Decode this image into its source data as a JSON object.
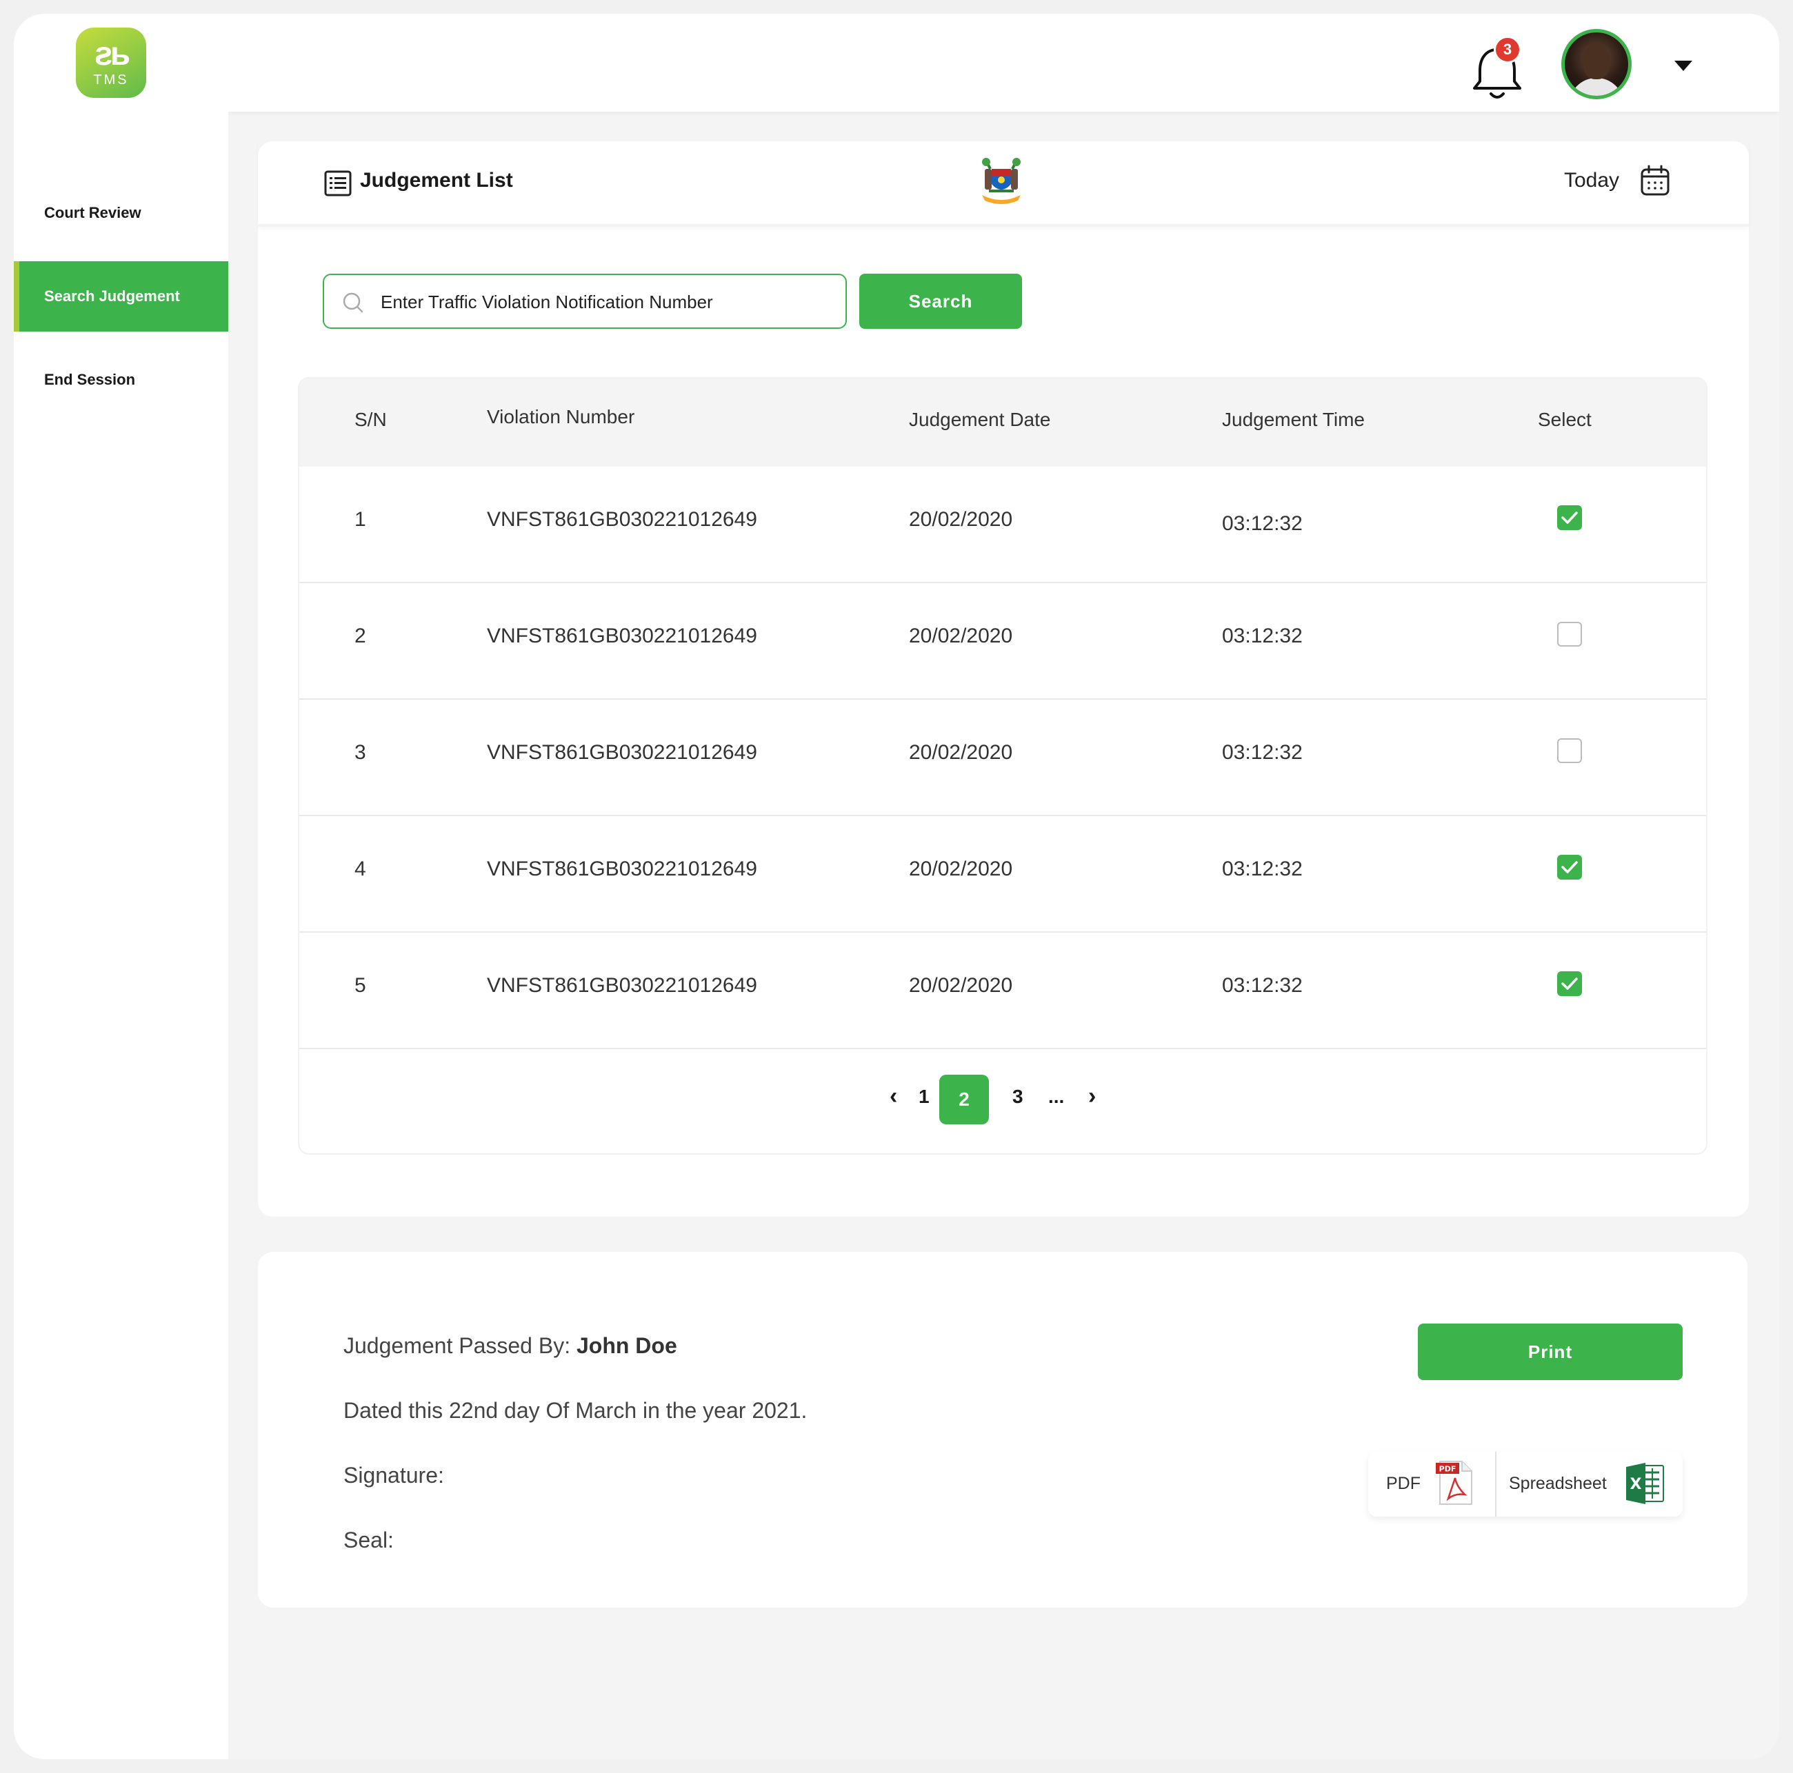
{
  "brand": {
    "logo_text": "TMS"
  },
  "header": {
    "notification_count": "3"
  },
  "sidebar": {
    "items": [
      {
        "label": "Court Review"
      },
      {
        "label": "Search Judgement"
      },
      {
        "label": "End Session"
      }
    ],
    "active_index": 1
  },
  "judgement_list": {
    "title": "Judgement List",
    "date_filter": "Today",
    "search": {
      "placeholder": "Enter Traffic Violation Notification Number",
      "button_label": "Search"
    },
    "columns": [
      "S/N",
      "Violation Number",
      "Judgement Date",
      "Judgement Time",
      "Select"
    ],
    "rows": [
      {
        "sn": "1",
        "violation_number": "VNFST861GB030221012649",
        "date": "20/02/2020",
        "time": "03:12:32",
        "selected": true
      },
      {
        "sn": "2",
        "violation_number": "VNFST861GB030221012649",
        "date": "20/02/2020",
        "time": "03:12:32",
        "selected": false
      },
      {
        "sn": "3",
        "violation_number": "VNFST861GB030221012649",
        "date": "20/02/2020",
        "time": "03:12:32",
        "selected": false
      },
      {
        "sn": "4",
        "violation_number": "VNFST861GB030221012649",
        "date": "20/02/2020",
        "time": "03:12:32",
        "selected": true
      },
      {
        "sn": "5",
        "violation_number": "VNFST861GB030221012649",
        "date": "20/02/2020",
        "time": "03:12:32",
        "selected": true
      }
    ],
    "pagination": {
      "prev": "‹",
      "pages": [
        "1",
        "2",
        "3"
      ],
      "current": "2",
      "ellipsis": "...",
      "next": "›"
    }
  },
  "judgement_details": {
    "passed_by_label": "Judgement Passed By:",
    "passed_by_name": "John Doe",
    "dated_text": "Dated this 22nd day Of March in the year 2021.",
    "signature_label": "Signature:",
    "seal_label": "Seal:",
    "print_label": "Print",
    "export": {
      "pdf_label": "PDF",
      "pdf_icon_text": "PDF",
      "spreadsheet_label": "Spreadsheet",
      "spreadsheet_icon_text": "X"
    }
  },
  "colors": {
    "accent": "#3db34b",
    "badge": "#e03a2f",
    "sidebar_active_border": "#a5c93a"
  }
}
